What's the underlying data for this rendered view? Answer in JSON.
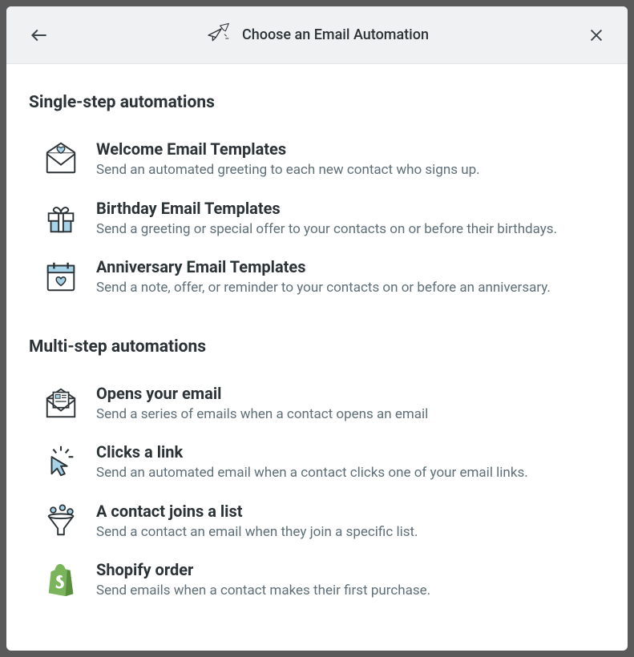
{
  "header": {
    "title": "Choose an Email Automation"
  },
  "sections": [
    {
      "title": "Single-step automations",
      "items": [
        {
          "title": "Welcome Email Templates",
          "desc": "Send an automated greeting to each new contact who signs up."
        },
        {
          "title": "Birthday Email Templates",
          "desc": "Send a greeting or special offer to your contacts on or before their birthdays."
        },
        {
          "title": "Anniversary Email Templates",
          "desc": "Send a note, offer, or reminder to your contacts on or before an anniversary."
        }
      ]
    },
    {
      "title": "Multi-step automations",
      "items": [
        {
          "title": "Opens your email",
          "desc": "Send a series of emails when a contact opens an email"
        },
        {
          "title": "Clicks a link",
          "desc": "Send an automated email when a contact clicks one of your email links."
        },
        {
          "title": "A contact joins a list",
          "desc": "Send a contact an email when they join a specific list."
        },
        {
          "title": "Shopify order",
          "desc": "Send emails when a contact makes their first purchase."
        }
      ]
    }
  ]
}
